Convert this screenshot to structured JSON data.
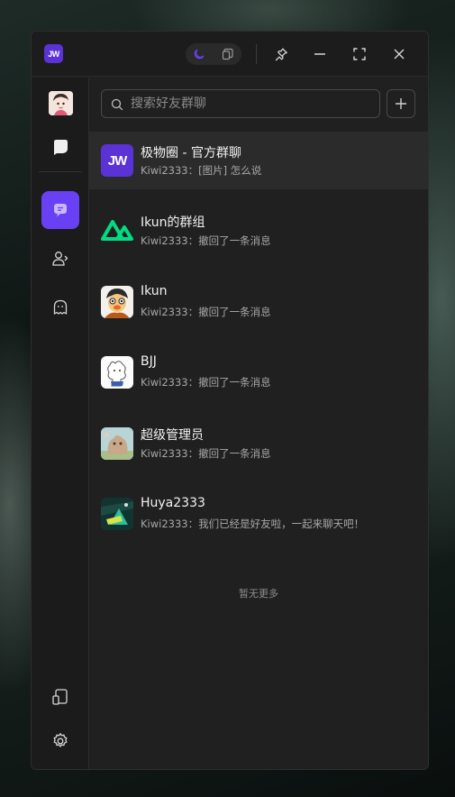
{
  "app": {
    "logo_text": "JW",
    "accent": "#6a40f5"
  },
  "titlebar": {
    "theme_modes": [
      "moon-icon",
      "window-icon"
    ],
    "buttons": [
      "pin-icon",
      "minimize-icon",
      "maximize-icon",
      "close-icon"
    ]
  },
  "sidebar": {
    "items": [
      {
        "name": "messages",
        "icon": "chat-bubble-icon",
        "active": true
      },
      {
        "name": "contacts",
        "icon": "contacts-icon",
        "active": false
      },
      {
        "name": "ghost",
        "icon": "ghost-icon",
        "active": false
      }
    ],
    "bottom": [
      "phone-tablet-icon",
      "gear-icon"
    ]
  },
  "search": {
    "placeholder": "搜索好友群聊",
    "value": ""
  },
  "chats": [
    {
      "name": "极物圈 - 官方群聊",
      "last_message": "Kiwi2333：[图片] 怎么说",
      "avatar": "jw-logo",
      "selected": true
    },
    {
      "name": "Ikun的群组",
      "last_message": "Kiwi2333：撤回了一条消息",
      "avatar": "nuxt-logo",
      "selected": false
    },
    {
      "name": "Ikun",
      "last_message": "Kiwi2333：撤回了一条消息",
      "avatar": "cartoon-avatar",
      "selected": false
    },
    {
      "name": "BJJ",
      "last_message": "Kiwi2333：撤回了一条消息",
      "avatar": "sketch-avatar",
      "selected": false
    },
    {
      "name": "超级管理员",
      "last_message": "Kiwi2333：撤回了一条消息",
      "avatar": "photo-avatar",
      "selected": false
    },
    {
      "name": "Huya2333",
      "last_message": "Kiwi2333：我们已经是好友啦，一起来聊天吧！",
      "avatar": "game-avatar",
      "selected": false
    }
  ],
  "list_footer": "暂无更多"
}
